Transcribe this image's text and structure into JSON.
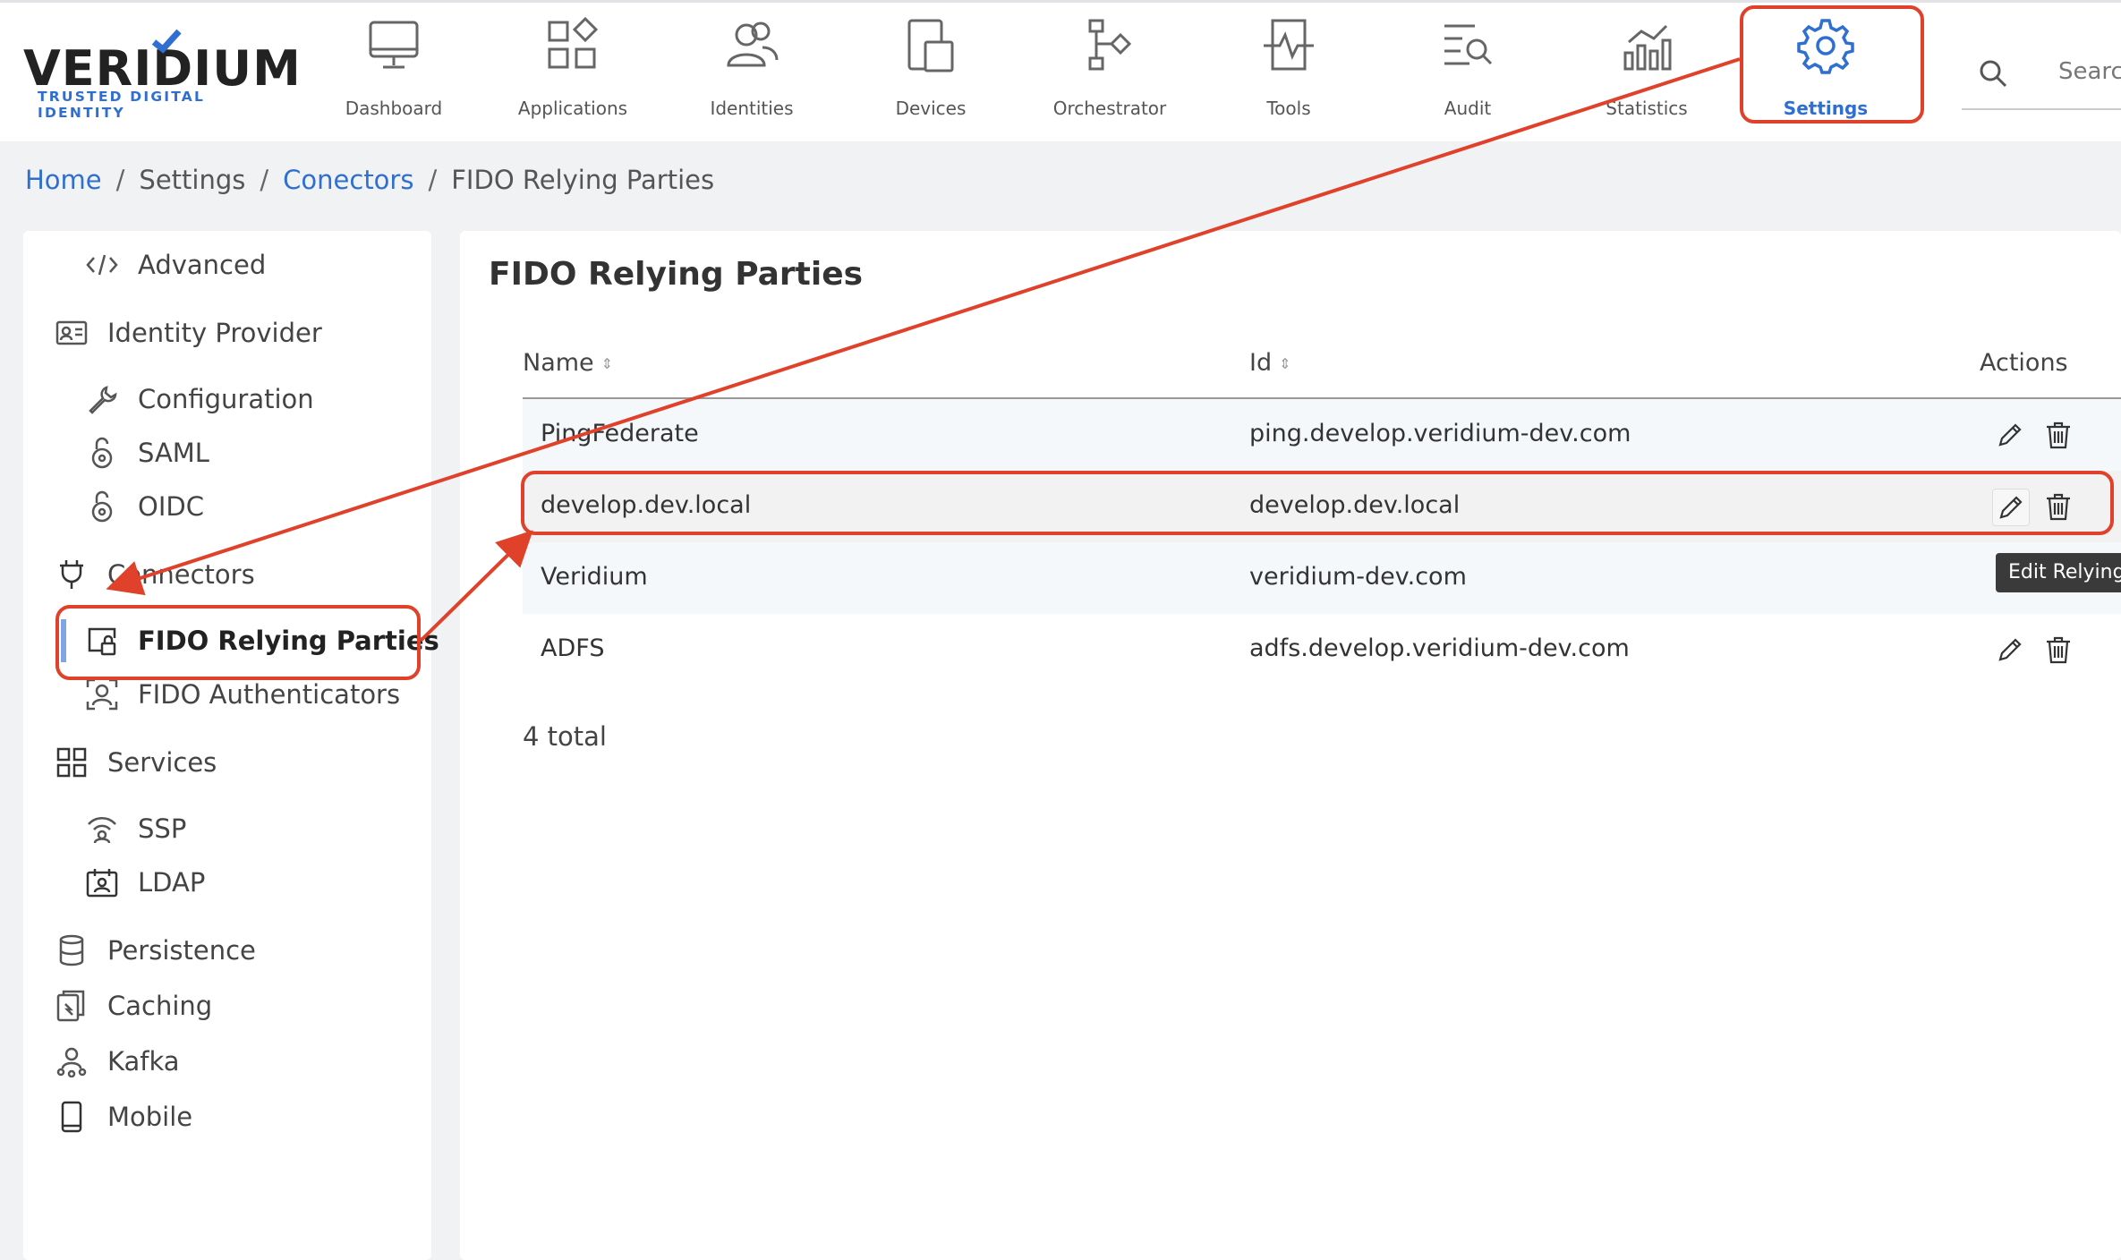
{
  "brand": {
    "name": "VERIDIUM",
    "tagline": "TRUSTED DIGITAL IDENTITY"
  },
  "nav": {
    "items": [
      {
        "label": "Dashboard",
        "icon": "monitor-icon"
      },
      {
        "label": "Applications",
        "icon": "apps-grid-icon"
      },
      {
        "label": "Identities",
        "icon": "users-icon"
      },
      {
        "label": "Devices",
        "icon": "devices-icon"
      },
      {
        "label": "Orchestrator",
        "icon": "flow-icon"
      },
      {
        "label": "Tools",
        "icon": "pulse-icon"
      },
      {
        "label": "Audit",
        "icon": "audit-search-icon"
      },
      {
        "label": "Statistics",
        "icon": "bar-chart-icon"
      },
      {
        "label": "Settings",
        "icon": "gear-icon",
        "active": true
      }
    ],
    "search_placeholder": "Search"
  },
  "breadcrumb": {
    "home": "Home",
    "settings": "Settings",
    "connectors": "Conectors",
    "current": "FIDO Relying Parties",
    "separator": "/"
  },
  "sidebar": {
    "advanced": "Advanced",
    "identity_provider": "Identity Provider",
    "configuration": "Configuration",
    "saml": "SAML",
    "oidc": "OIDC",
    "connectors": "Connectors",
    "fido_relying_parties": "FIDO Relying Parties",
    "fido_authenticators": "FIDO Authenticators",
    "services": "Services",
    "ssp": "SSP",
    "ldap": "LDAP",
    "persistence": "Persistence",
    "caching": "Caching",
    "kafka": "Kafka",
    "mobile": "Mobile"
  },
  "main": {
    "title": "FIDO Relying Parties",
    "columns": {
      "name": "Name",
      "id": "Id",
      "actions": "Actions"
    },
    "sort_glyph": "⇕",
    "rows": [
      {
        "name": "PingFederate",
        "id": "ping.develop.veridium-dev.com"
      },
      {
        "name": "develop.dev.local",
        "id": "develop.dev.local"
      },
      {
        "name": "Veridium",
        "id": "veridium-dev.com"
      },
      {
        "name": "ADFS",
        "id": "adfs.develop.veridium-dev.com"
      }
    ],
    "total": "4 total",
    "tooltip": "Edit Relying"
  },
  "colors": {
    "accent": "#2f6fd1",
    "annotation": "#e0412a"
  }
}
